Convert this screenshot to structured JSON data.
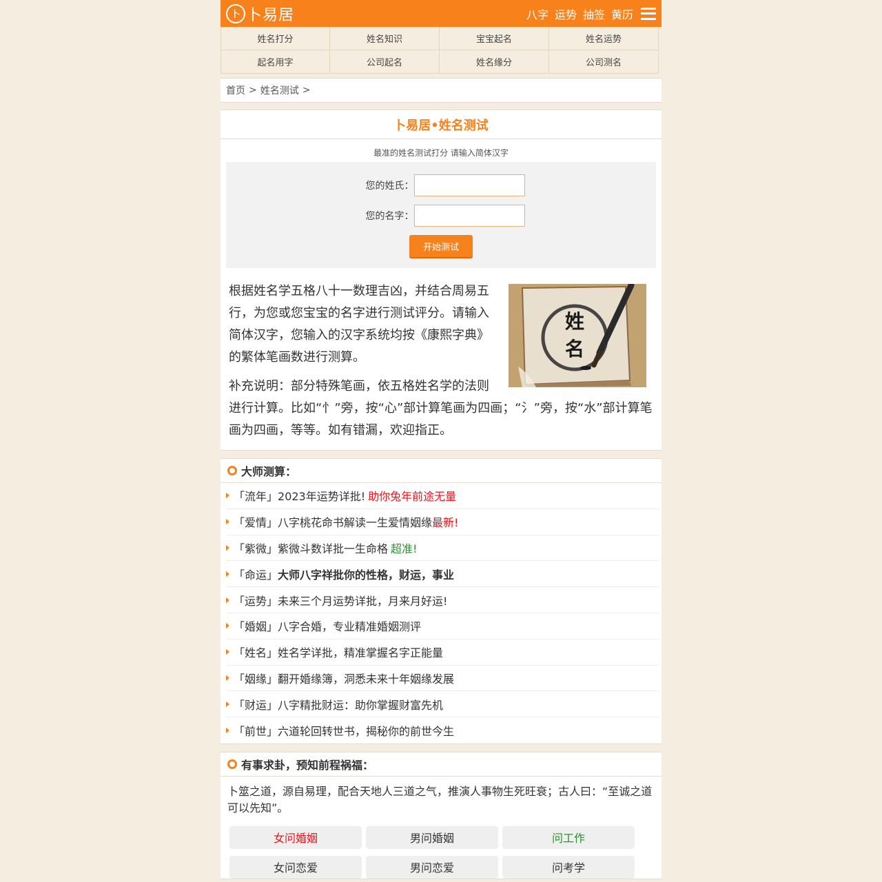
{
  "header": {
    "logo_mark": "卜",
    "logo_text": "卜易居",
    "nav": [
      "八字",
      "运势",
      "抽签",
      "黄历"
    ]
  },
  "subnav": [
    "姓名打分",
    "姓名知识",
    "宝宝起名",
    "姓名运势",
    "起名用字",
    "公司起名",
    "姓名缘分",
    "公司测名"
  ],
  "breadcrumb": {
    "home": "首页",
    "sep": ">",
    "current": "姓名测试"
  },
  "test": {
    "title": "卜易居•姓名测试",
    "subtitle": "最准的姓名测试打分 请输入简体汉字",
    "surname_label": "您的姓氏：",
    "name_label": "您的名字：",
    "surname_value": "",
    "name_value": "",
    "button": "开始测试",
    "image_chars": [
      "姓",
      "名"
    ],
    "intro_1": "根据姓名学五格八十一数理吉凶，并结合周易五行，为您或您宝宝的名字进行测试评分。请输入简体汉字，您输入的汉字系统均按《康熙字典》的繁体笔画数进行测算。",
    "intro_2": "补充说明：部分特殊笔画，依五格姓名学的法则进行计算。比如“忄”旁，按“心”部计算笔画为四画；“氵”旁，按“水”部计算笔画为四画，等等。如有错漏，欢迎指正。"
  },
  "master": {
    "title": "大师测算：",
    "items": [
      {
        "prefix": "「流年」",
        "text": "2023年运势详批!",
        "extra": "助你兔年前途无量",
        "style": "extra-red"
      },
      {
        "prefix": "「爱情」",
        "text": "八字桃花命书解读一生爱情姻缘",
        "extra": "最新!",
        "style": "extra-red"
      },
      {
        "prefix": "「紫微」",
        "text": "紫微斗数详批一生命格",
        "extra": "超准!",
        "style": "extra-green"
      },
      {
        "prefix": "「命运」",
        "text": "大师八字祥批你的性格，财运，事业",
        "extra": "",
        "style": "bold"
      },
      {
        "prefix": "「运势」",
        "text": "未来三个月运势详批，月来月好运!",
        "extra": "",
        "style": "plain"
      },
      {
        "prefix": "「婚姻」",
        "text": "八字合婚，专业精准婚姻测评",
        "extra": "",
        "style": "all-red"
      },
      {
        "prefix": "「姓名」",
        "text": "姓名学详批，精准掌握名字正能量",
        "extra": "",
        "style": "plain"
      },
      {
        "prefix": "「姻缘」",
        "text": "翻开婚缘簿，洞悉未来十年姻缘发展",
        "extra": "",
        "style": "all-blue"
      },
      {
        "prefix": "「财运」",
        "text": "八字精批财运：助你掌握财富先机",
        "extra": "",
        "style": "plain"
      },
      {
        "prefix": "「前世」",
        "text": "六道轮回转世书，揭秘你的前世今生",
        "extra": "",
        "style": "plain"
      }
    ]
  },
  "gua": {
    "title": "有事求卦，预知前程祸福：",
    "intro": "卜筮之道，源自易理，配合天地人三道之气，推演人事物生死旺衰；古人曰：“至诚之道可以先知”。",
    "buttons": [
      {
        "label": "女问婚姻",
        "color": "red"
      },
      {
        "label": "男问婚姻",
        "color": ""
      },
      {
        "label": "问工作",
        "color": "green"
      },
      {
        "label": "女问恋爱",
        "color": ""
      },
      {
        "label": "男问恋爱",
        "color": ""
      },
      {
        "label": "问考学",
        "color": ""
      }
    ]
  }
}
